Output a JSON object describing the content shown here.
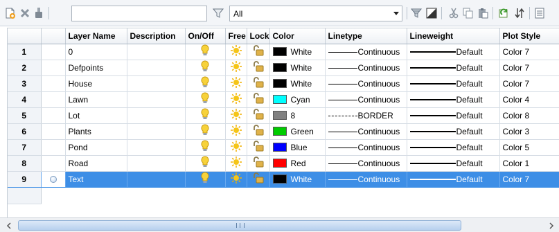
{
  "toolbar": {
    "icons": [
      "new-layer-icon",
      "delete-layer-icon",
      "set-current-icon",
      "filter-invert-icon",
      "filter-settings-icon",
      "layer-state-icon",
      "cut-icon",
      "copy-icon",
      "paste-icon",
      "refresh-icon",
      "sort-icon"
    ],
    "search_value": "",
    "filter_value": "All"
  },
  "columns": [
    "",
    "",
    "Layer Name",
    "Description",
    "On/Off",
    "Free",
    "Lock",
    "Color",
    "Linetype",
    "Lineweight",
    "Plot Style"
  ],
  "rows": [
    {
      "num": "1",
      "name": "0",
      "description": "",
      "color_name": "White",
      "color_hex": "#000000",
      "linetype": "Continuous",
      "linetype_style": "solid",
      "lineweight": "Default",
      "plot_style": "Color 7"
    },
    {
      "num": "2",
      "name": "Defpoints",
      "description": "",
      "color_name": "White",
      "color_hex": "#000000",
      "linetype": "Continuous",
      "linetype_style": "solid",
      "lineweight": "Default",
      "plot_style": "Color 7"
    },
    {
      "num": "3",
      "name": "House",
      "description": "",
      "color_name": "White",
      "color_hex": "#000000",
      "linetype": "Continuous",
      "linetype_style": "solid",
      "lineweight": "Default",
      "plot_style": "Color 7"
    },
    {
      "num": "4",
      "name": "Lawn",
      "description": "",
      "color_name": "Cyan",
      "color_hex": "#00ffff",
      "linetype": "Continuous",
      "linetype_style": "solid",
      "lineweight": "Default",
      "plot_style": "Color 4"
    },
    {
      "num": "5",
      "name": "Lot",
      "description": "",
      "color_name": "8",
      "color_hex": "#808080",
      "linetype": "BORDER",
      "linetype_style": "dashed",
      "lineweight": "Default",
      "plot_style": "Color 8"
    },
    {
      "num": "6",
      "name": "Plants",
      "description": "",
      "color_name": "Green",
      "color_hex": "#00cc00",
      "linetype": "Continuous",
      "linetype_style": "solid",
      "lineweight": "Default",
      "plot_style": "Color 3"
    },
    {
      "num": "7",
      "name": "Pond",
      "description": "",
      "color_name": "Blue",
      "color_hex": "#0000ff",
      "linetype": "Continuous",
      "linetype_style": "solid",
      "lineweight": "Default",
      "plot_style": "Color 5"
    },
    {
      "num": "8",
      "name": "Road",
      "description": "",
      "color_name": "Red",
      "color_hex": "#ff0000",
      "linetype": "Continuous",
      "linetype_style": "solid",
      "lineweight": "Default",
      "plot_style": "Color 1"
    },
    {
      "num": "9",
      "name": "Text",
      "description": "",
      "color_name": "White",
      "color_hex": "#000000",
      "linetype": "Continuous",
      "linetype_style": "solid",
      "lineweight": "Default",
      "plot_style": "Color 7",
      "selected": true
    }
  ],
  "row_icons": {
    "on_off": "lightbulb-icon",
    "freeze": "sun-icon",
    "lock": "unlocked-padlock-icon"
  },
  "colors": {
    "selection": "#3d8ee6",
    "bulb": "#f7d23a",
    "sun": "#f5c518"
  },
  "scrollbar": {
    "grip": "III"
  }
}
